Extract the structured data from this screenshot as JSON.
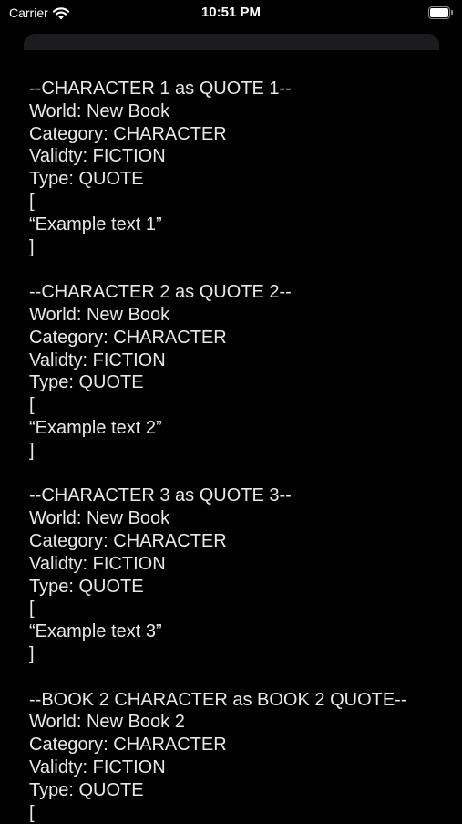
{
  "status_bar": {
    "carrier": "Carrier",
    "time": "10:51 PM",
    "battery_level": 1.0
  },
  "entries": [
    {
      "header": "--CHARACTER 1 as QUOTE 1--",
      "world": "World: New Book",
      "category": "Category: CHARACTER",
      "validity": "Validty: FICTION",
      "type": "Type: QUOTE",
      "open_bracket": "[",
      "text": "“Example text 1”",
      "close_bracket": "]"
    },
    {
      "header": "--CHARACTER 2 as QUOTE 2--",
      "world": "World: New Book",
      "category": "Category: CHARACTER",
      "validity": "Validty: FICTION",
      "type": "Type: QUOTE",
      "open_bracket": "[",
      "text": "“Example text 2”",
      "close_bracket": "]"
    },
    {
      "header": "--CHARACTER 3 as QUOTE 3--",
      "world": "World: New Book",
      "category": "Category: CHARACTER",
      "validity": "Validty: FICTION",
      "type": "Type: QUOTE",
      "open_bracket": "[",
      "text": "“Example text 3”",
      "close_bracket": "]"
    },
    {
      "header": "--BOOK 2 CHARACTER as BOOK 2 QUOTE--",
      "world": "World: New Book 2",
      "category": "Category: CHARACTER",
      "validity": "Validty: FICTION",
      "type": "Type: QUOTE",
      "open_bracket": "["
    }
  ]
}
